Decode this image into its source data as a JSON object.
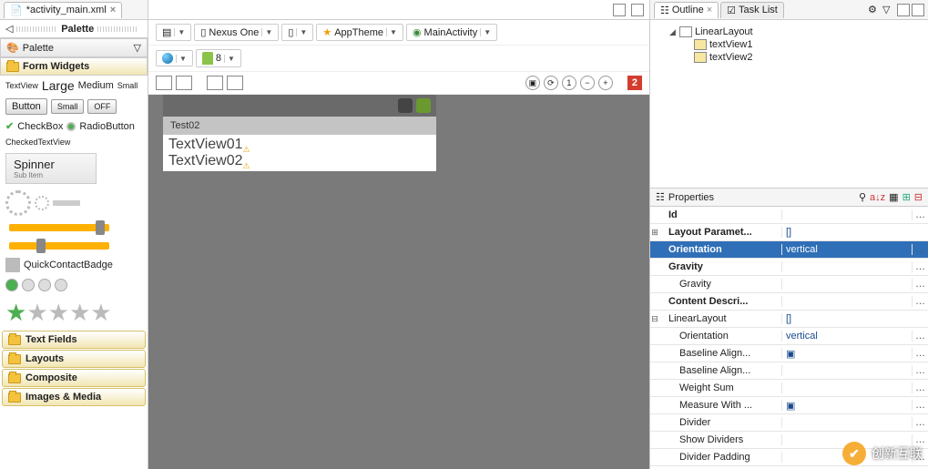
{
  "editor_tab": {
    "filename": "*activity_main.xml"
  },
  "palette": {
    "title": "Palette",
    "dropdown_label": "Palette",
    "form_widgets": "Form Widgets",
    "text_sizes": {
      "textview": "TextView",
      "large": "Large",
      "medium": "Medium",
      "small": "Small"
    },
    "buttons": {
      "button": "Button",
      "small": "Small",
      "off": "OFF"
    },
    "checkbox": "CheckBox",
    "radiobutton": "RadioButton",
    "checkedtextview": "CheckedTextView",
    "spinner": {
      "title": "Spinner",
      "sub": "Sub Item"
    },
    "quickcontact": "QuickContactBadge",
    "folders": [
      "Text Fields",
      "Layouts",
      "Composite",
      "Images & Media"
    ]
  },
  "toolbar": {
    "device": "Nexus One",
    "theme_prefix": "AppTheme",
    "activity": "MainActivity",
    "api": "8"
  },
  "zoom": {
    "errors": "2"
  },
  "phone": {
    "title": "Test02",
    "tv1": "TextView01",
    "tv2": "TextView02"
  },
  "outline": {
    "tab": "Outline",
    "tasklist": "Task List",
    "root": "LinearLayout",
    "children": [
      "textView1",
      "textView2"
    ]
  },
  "props": {
    "title": "Properties",
    "rows": [
      {
        "name": "Id",
        "val": "",
        "bold": true,
        "btn": true
      },
      {
        "name": "Layout Paramet...",
        "val": "[]",
        "bold": true,
        "exp": "+"
      },
      {
        "name": "Orientation",
        "val": "vertical",
        "bold": true,
        "sel": true,
        "btn": true
      },
      {
        "name": "Gravity",
        "val": "",
        "bold": true,
        "btn": true
      },
      {
        "name": "Gravity",
        "val": "",
        "ind": 1,
        "btn": true
      },
      {
        "name": "Content Descri...",
        "val": "",
        "bold": true,
        "btn": true
      },
      {
        "name": "LinearLayout",
        "val": "[]",
        "exp": "-"
      },
      {
        "name": "Orientation",
        "val": "vertical",
        "ind": 1,
        "btn": true
      },
      {
        "name": "Baseline Align...",
        "val": "▣",
        "ind": 1,
        "btn": true
      },
      {
        "name": "Baseline Align...",
        "val": "",
        "ind": 1,
        "btn": true
      },
      {
        "name": "Weight Sum",
        "val": "",
        "ind": 1,
        "btn": true
      },
      {
        "name": "Measure With ...",
        "val": "▣",
        "ind": 1,
        "btn": true
      },
      {
        "name": "Divider",
        "val": "",
        "ind": 1,
        "btn": true
      },
      {
        "name": "Show Dividers",
        "val": "",
        "ind": 1,
        "btn": true
      },
      {
        "name": "Divider Padding",
        "val": "",
        "ind": 1,
        "btn": true
      }
    ]
  },
  "watermark": "创新互联"
}
